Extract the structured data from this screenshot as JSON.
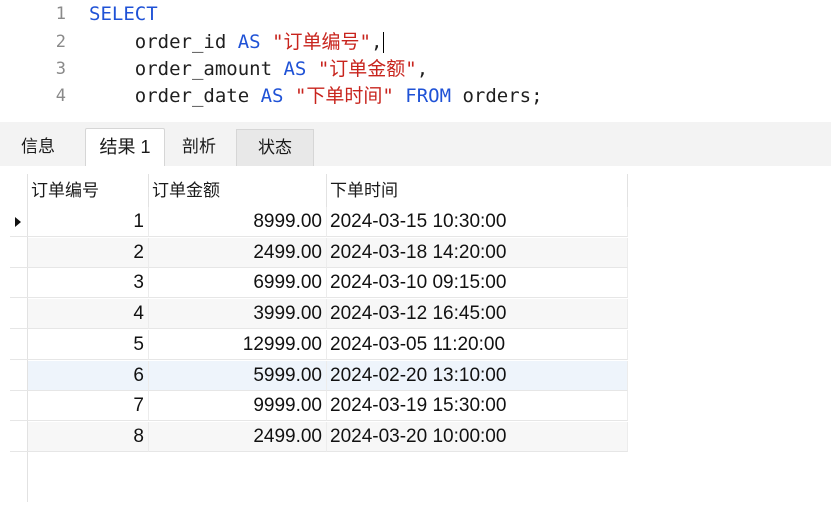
{
  "editor": {
    "lines": [
      {
        "num": "1",
        "parts": [
          {
            "t": "SELECT",
            "k": "kw"
          }
        ]
      },
      {
        "num": "2",
        "parts": [
          {
            "t": "    order_id ",
            "k": ""
          },
          {
            "t": "AS",
            "k": "kw"
          },
          {
            "t": " ",
            "k": ""
          },
          {
            "t": "\"订单编号\"",
            "k": "str"
          },
          {
            "t": ",",
            "k": ""
          }
        ],
        "caret": true
      },
      {
        "num": "3",
        "parts": [
          {
            "t": "    order_amount ",
            "k": ""
          },
          {
            "t": "AS",
            "k": "kw"
          },
          {
            "t": " ",
            "k": ""
          },
          {
            "t": "\"订单金额\"",
            "k": "str"
          },
          {
            "t": ",",
            "k": ""
          }
        ]
      },
      {
        "num": "4",
        "parts": [
          {
            "t": "    order_date ",
            "k": ""
          },
          {
            "t": "AS",
            "k": "kw"
          },
          {
            "t": " ",
            "k": ""
          },
          {
            "t": "\"下单时间\"",
            "k": "str"
          },
          {
            "t": " ",
            "k": ""
          },
          {
            "t": "FROM",
            "k": "kw"
          },
          {
            "t": " orders;",
            "k": ""
          }
        ]
      }
    ],
    "colors": {
      "keyword": "#1f52d6",
      "string": "#c8241d",
      "text": "#1f1f1f"
    }
  },
  "tabs": [
    {
      "label": "信息",
      "active": false
    },
    {
      "label": "结果 1",
      "active": true
    },
    {
      "label": "剖析",
      "active": false
    },
    {
      "label": "状态",
      "active": false
    }
  ],
  "table": {
    "columns": [
      "订单编号",
      "订单金额",
      "下单时间"
    ],
    "rows": [
      [
        "1",
        "8999.00",
        "2024-03-15 10:30:00"
      ],
      [
        "2",
        "2499.00",
        "2024-03-18 14:20:00"
      ],
      [
        "3",
        "6999.00",
        "2024-03-10 09:15:00"
      ],
      [
        "4",
        "3999.00",
        "2024-03-12 16:45:00"
      ],
      [
        "5",
        "12999.00",
        "2024-03-05 11:20:00"
      ],
      [
        "6",
        "5999.00",
        "2024-02-20 13:10:00"
      ],
      [
        "7",
        "9999.00",
        "2024-03-19 15:30:00"
      ],
      [
        "8",
        "2499.00",
        "2024-03-20 10:00:00"
      ]
    ],
    "current_row_index": 0,
    "highlighted_row_index": 5
  }
}
